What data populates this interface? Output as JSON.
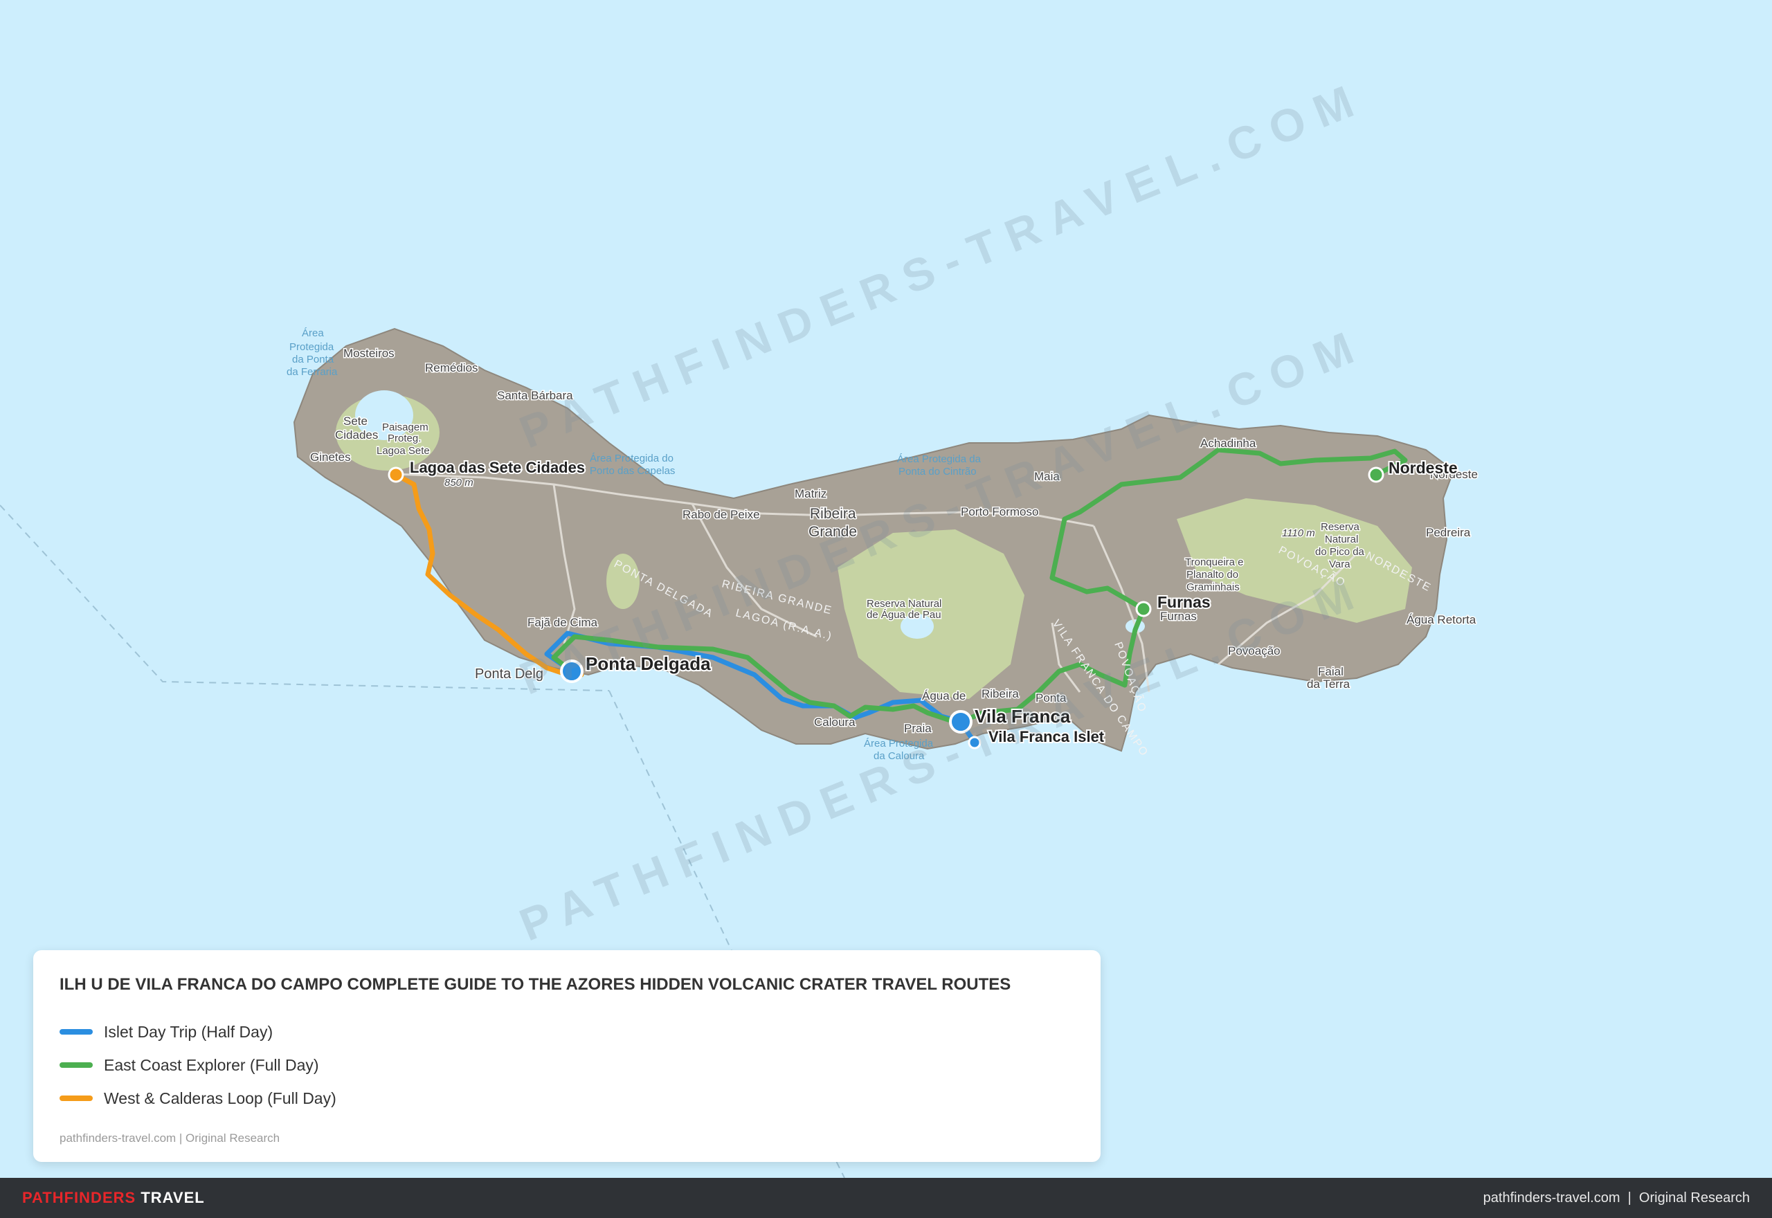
{
  "map": {
    "places": {
      "mosteiros": "Mosteiros",
      "remedios": "Remédios",
      "santa_barbara": "Santa Bárbara",
      "sete": "Sete",
      "cidades": "Cidades",
      "ginetes": "Ginetes",
      "paisagem1": "Paisagem",
      "paisagem2": "Proteg.",
      "paisagem3": "Lagoa Sete",
      "altitude_sete": "850 m",
      "altitude_pico": "1110 m",
      "rabo_de_peixe": "Rabo de Peixe",
      "matriz": "Matriz",
      "ribeira1": "Ribeira",
      "ribeira2": "Grande",
      "maia": "Maia",
      "porto_formoso": "Porto Formoso",
      "achadinha": "Achadinha",
      "nordeste_town": "Nordeste",
      "pedreira": "Pedreira",
      "agua_retorta": "Água Retorta",
      "faial1": "Faial",
      "faial2": "da Terra",
      "povoacao": "Povoação",
      "furnas_town": "Furnas",
      "faja_de_cima": "Fajã de Cima",
      "ponta_delgada_town": "Ponta Delg",
      "caloura": "Caloura",
      "praia": "Praia",
      "agua_de": "Água de",
      "ribeira_ch": "Ribeira",
      "ponta": "Ponta",
      "reserva1": "Reserva Natural",
      "reserva2": "de Água de Pau",
      "tronqueira1": "Tronqueira e",
      "tronqueira2": "Planalto do",
      "tronqueira3": "Graminhais",
      "reserva_pico1": "Reserva",
      "reserva_pico2": "Natural",
      "reserva_pico3": "do Pico da",
      "reserva_pico4": "Vara",
      "area_ferraria1": "Área",
      "area_ferraria2": "Protegida",
      "area_ferraria3": "da Ponta",
      "area_ferraria4": "da Ferraria",
      "area_capelas1": "Área Protegida do",
      "area_capelas2": "Porto das Capelas",
      "area_cintrao1": "Área Protegida da",
      "area_cintrao2": "Ponta do Cintrão",
      "area_caloura1": "Área Protegida",
      "area_caloura2": "da Caloura",
      "road_ponta_delgada": "PONTA DELGADA",
      "road_ribeira_grande": "RIBEIRA GRANDE",
      "road_lagoa": "LAGOA (R.A.A.)",
      "road_vila_franca": "VILA FRANCA DO CAMPO",
      "road_povoacao": "POVOAÇÃO",
      "road_nordeste": "NORDESTE"
    },
    "points": {
      "lagoa_sete_cidades": "Lagoa das Sete Cidades",
      "ponta_delgada": "Ponta Delgada",
      "vila_franca": "Vila Franca",
      "vila_franca_islet": "Vila Franca Islet",
      "furnas": "Furnas",
      "nordeste": "Nordeste"
    },
    "watermark": "PATHFINDERS-TRAVEL.COM"
  },
  "legend": {
    "title": "ILH U DE VILA FRANCA DO CAMPO COMPLETE GUIDE TO THE AZORES HIDDEN VOLCANIC CRATER TRAVEL ROUTES",
    "routes": [
      {
        "label": "Islet Day Trip (Half Day)",
        "color": "#2b8ee0"
      },
      {
        "label": "East Coast Explorer (Full Day)",
        "color": "#4caf50"
      },
      {
        "label": "West & Calderas Loop (Full Day)",
        "color": "#f59c1a"
      }
    ],
    "credit": "pathfinders-travel.com | Original Research"
  },
  "footer": {
    "brand_a": "PATHFINDERS",
    "brand_b": "TRAVEL",
    "right": "pathfinders-travel.com  |  Original Research"
  }
}
